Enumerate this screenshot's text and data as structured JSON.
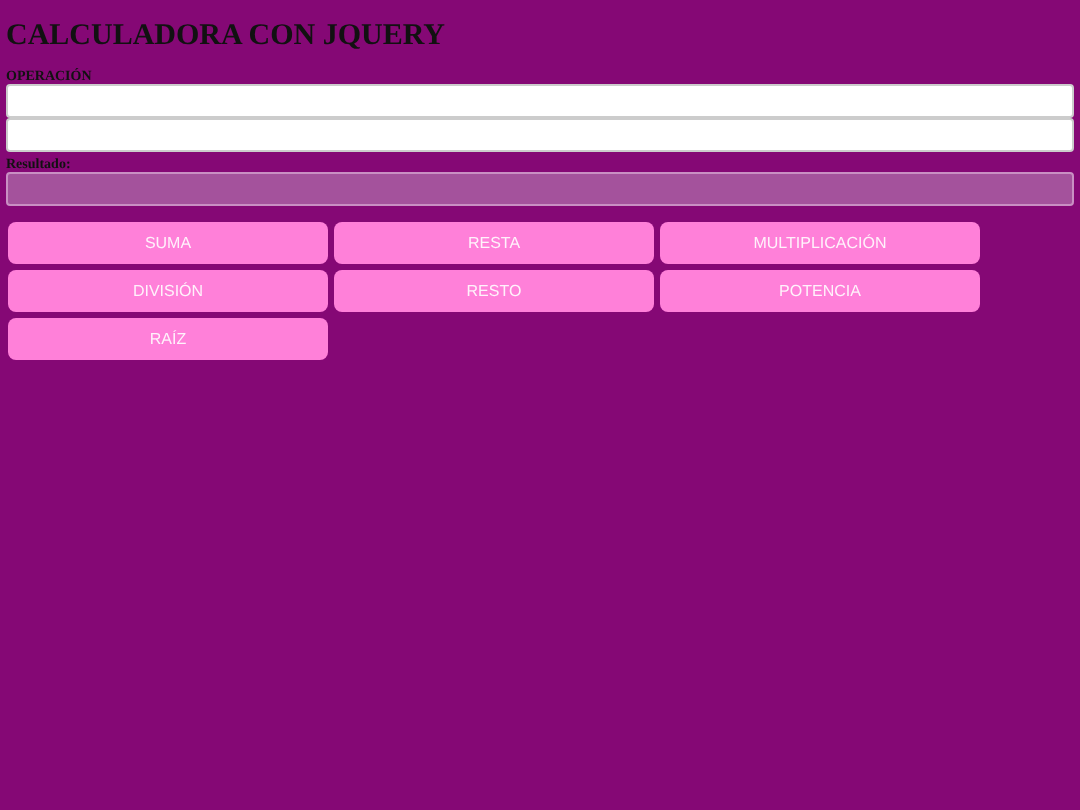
{
  "title": "CALCULADORA CON JQUERY",
  "operation": {
    "label": "OPERACIÓN",
    "fields": [
      {
        "kind": "input"
      },
      {
        "kind": "input"
      }
    ]
  },
  "result": {
    "label": "Resultado:",
    "kind": "readonly"
  },
  "buttons": [
    "SUMA",
    "RESTA",
    "MULTIPLICACIÓN",
    "DIVISIÓN",
    "RESTO",
    "POTENCIA",
    "RAÍZ"
  ]
}
